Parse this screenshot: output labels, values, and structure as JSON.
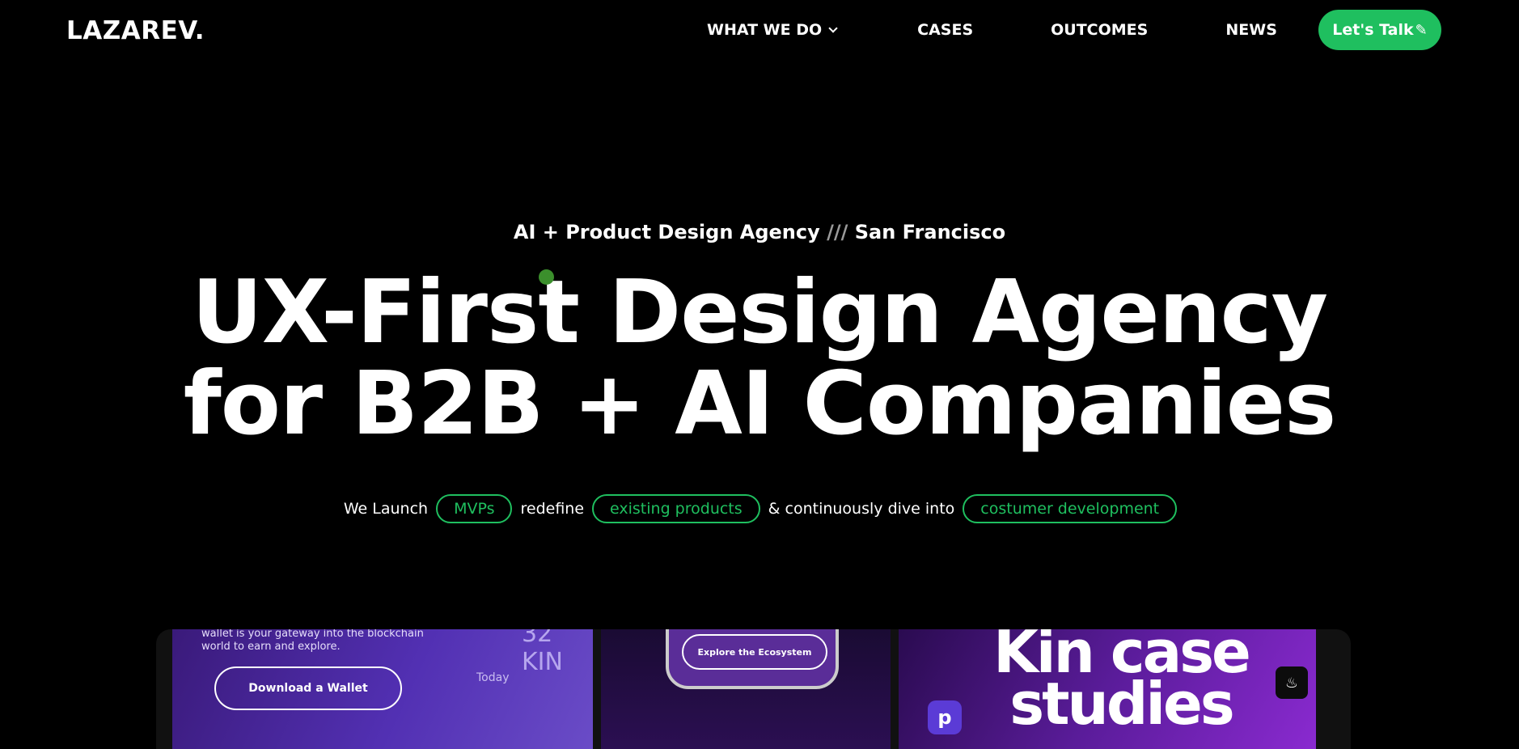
{
  "header": {
    "logo": "LAZAREV.",
    "nav": [
      {
        "label": "WHAT WE DO"
      },
      {
        "label": "CASES"
      },
      {
        "label": "OUTCOMES"
      },
      {
        "label": "NEWS"
      }
    ],
    "cta_label": "Let's Talk"
  },
  "hero": {
    "tagline_part1": "AI + Product Design Agency ",
    "tagline_slashes": "///",
    "tagline_part2": " San Francisco",
    "headline_line1": "UX-First Design Agency",
    "headline_line2": "for B2B + AI Companies",
    "sub": {
      "t1": "We Launch",
      "pill1": "MVPs",
      "t2": "redefine",
      "pill2": "existing products",
      "t3": "& continuously dive into",
      "pill3": "costumer development"
    }
  },
  "showcase": {
    "panel1_text_line1": "wallet is your gateway into the blockchain",
    "panel1_text_line2": "world to earn and explore.",
    "panel1_button": "Download a Wallet",
    "panel1_kin": "32 KIN",
    "panel1_today": "Today",
    "panel2_button": "Explore the Ecosystem",
    "panel3_title_line1": "Kin case",
    "panel3_title_line2": "studies",
    "panel3_app_icon_letter": "p"
  },
  "colors": {
    "background": "#000000",
    "accent_green": "#1fbf5f"
  }
}
